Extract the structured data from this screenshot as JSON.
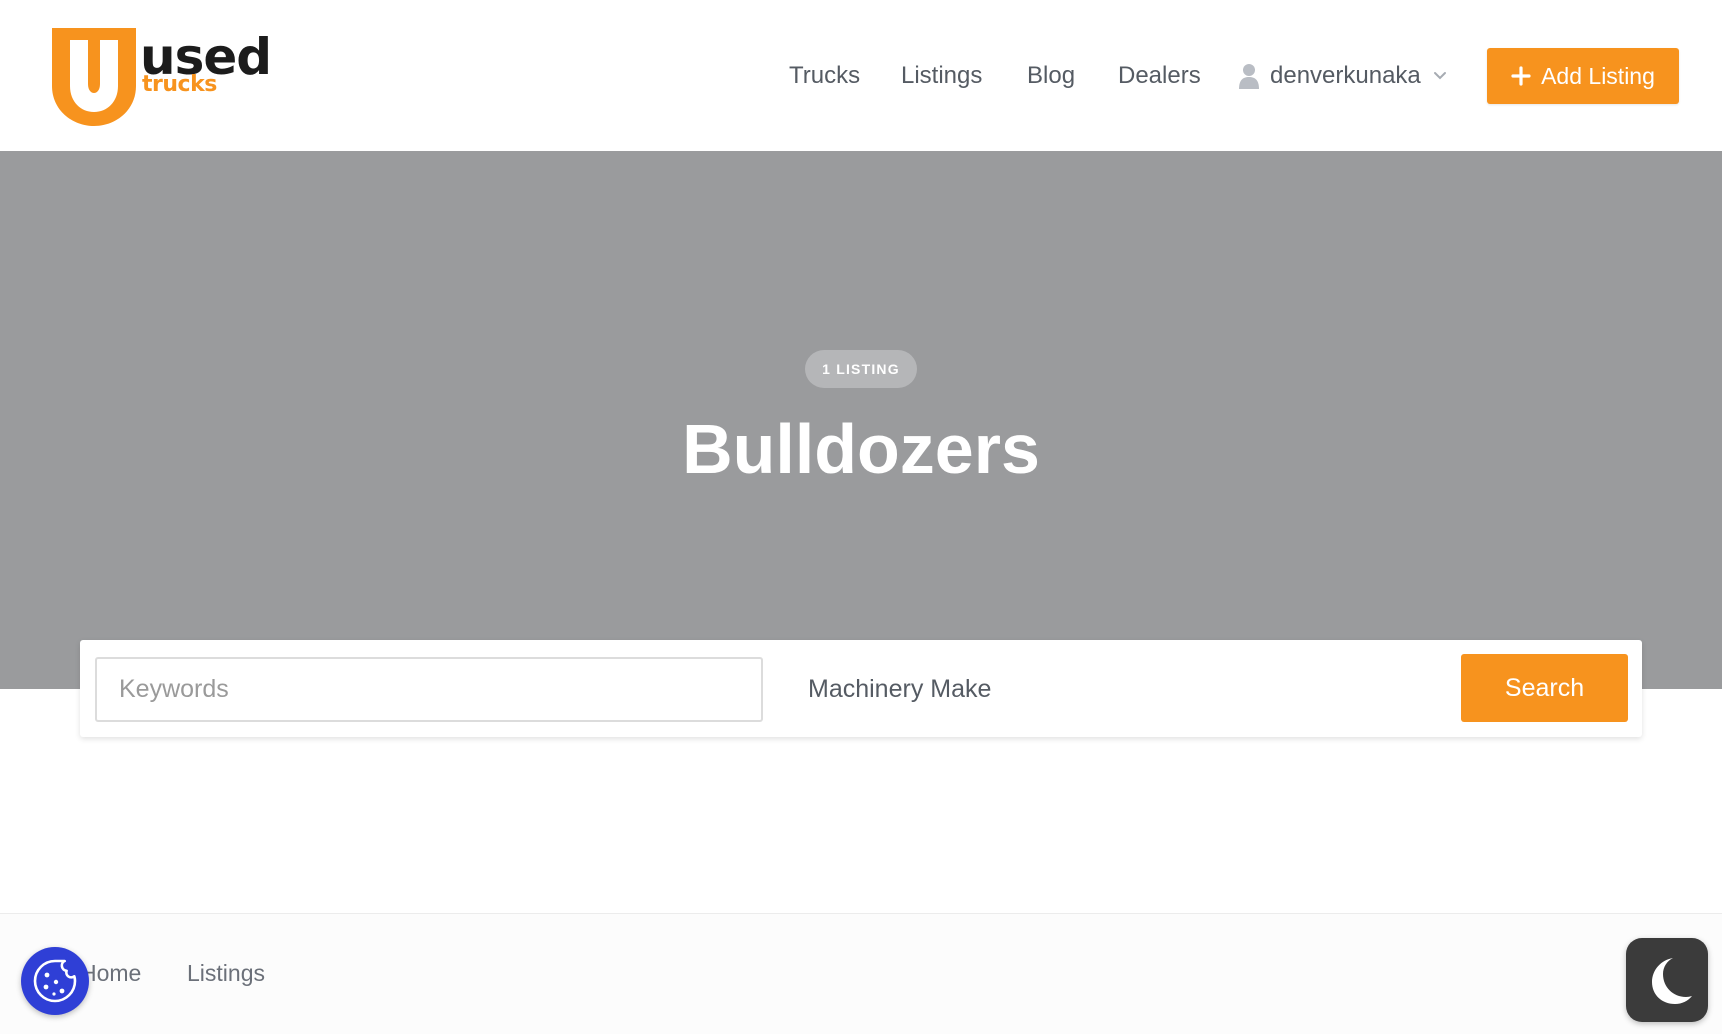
{
  "brand": {
    "logo_letter": "U",
    "logo_word_top": "used",
    "logo_word_bottom": "trucks",
    "primary_color": "#f7931e"
  },
  "nav": {
    "items": [
      {
        "label": "Trucks"
      },
      {
        "label": "Listings"
      },
      {
        "label": "Blog"
      },
      {
        "label": "Dealers"
      }
    ],
    "user": {
      "name": "denverkunaka",
      "icon": "user-icon"
    },
    "add_listing_label": "Add Listing"
  },
  "hero": {
    "badge": "1 LISTING",
    "title": "Bulldozers",
    "background_color": "#9a9b9d"
  },
  "search": {
    "keywords_placeholder": "Keywords",
    "keywords_value": "",
    "make_selected": "Machinery Make",
    "button_label": "Search"
  },
  "breadcrumb": {
    "items": [
      {
        "label": "Home"
      },
      {
        "label": "Listings"
      }
    ]
  },
  "floating": {
    "cookie_icon": "cookie-icon",
    "dark_mode_icon": "moon-icon",
    "cookie_color": "#2f3fd6"
  }
}
